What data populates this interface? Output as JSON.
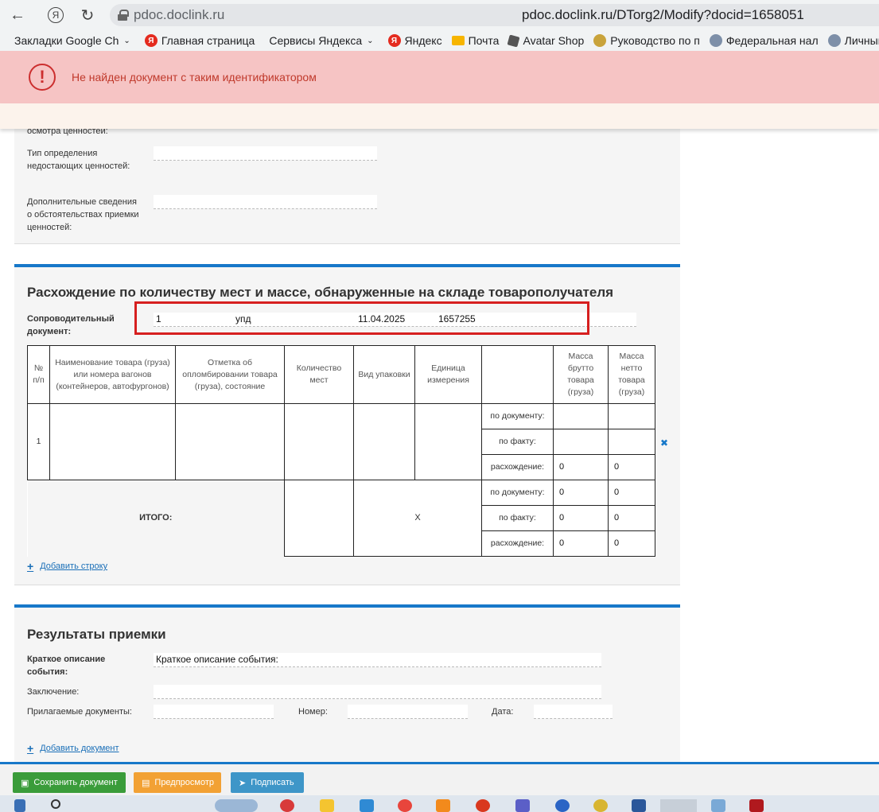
{
  "browser": {
    "host": "pdoc.doclink.ru",
    "url": "pdoc.doclink.ru/DTorg2/Modify?docid=1658051",
    "bookmarks": [
      {
        "label": "Закладки Google Ch",
        "icon": "none"
      },
      {
        "label": "Главная страница",
        "icon": "yandex-icon"
      },
      {
        "label": "Сервисы Яндекса",
        "icon": "none"
      },
      {
        "label": "Яндекс",
        "icon": "yandex-icon"
      },
      {
        "label": "Почта",
        "icon": "mail-icon"
      },
      {
        "label": "Avatar Shop",
        "icon": "shop-icon"
      },
      {
        "label": "Руководство по п",
        "icon": "gear-icon"
      },
      {
        "label": "Федеральная нал",
        "icon": "fns-icon"
      },
      {
        "label": "Личный кабине",
        "icon": "fns-icon"
      }
    ]
  },
  "error": {
    "message": "Не найден документ с таким идентификатором"
  },
  "section_top": {
    "label_cut": "осмотра ценностей:",
    "shortage_type_label": "Тип определения недостающих ценностей:",
    "additional_info_label": "Дополнительные сведения о обстоятельствах приемки ценностей:"
  },
  "discrepancy": {
    "title": "Расхождение по количеству мест и массе, обнаруженные на складе товарополучателя",
    "doc_label": "Сопроводительный документ:",
    "doc_fields": {
      "number": "1",
      "type": "упд",
      "date": "11.04.2025",
      "id": "1657255"
    },
    "headers": {
      "num": "№ п/п",
      "name": "Наименование товара (груза) или номера вагонов (контейнеров, автофургонов)",
      "seal": "Отметка об опломбировании товара (груза), состояние",
      "places": "Количество мест",
      "package": "Вид упаковки",
      "unit": "Единица измерения",
      "gross": "Масса брутто товара (груза)",
      "net": "Масса нетто товара (груза)"
    },
    "row": {
      "num": "1",
      "by_doc": "по документу:",
      "by_fact": "по факту:",
      "diff": "расхождение:",
      "diff_gross": "0",
      "diff_net": "0"
    },
    "total": {
      "label": "ИТОГО:",
      "x": "X",
      "by_doc": "по документу:",
      "by_fact": "по факту:",
      "diff": "расхождение:",
      "doc_gross": "0",
      "doc_net": "0",
      "fact_gross": "0",
      "fact_net": "0",
      "diff_gross": "0",
      "diff_net": "0"
    },
    "add_row": "Добавить строку"
  },
  "results": {
    "title": "Результаты приемки",
    "brief_label": "Краткое описание события:",
    "brief_value": "Краткое описание события:",
    "conclusion_label": "Заключение:",
    "attached_label": "Прилагаемые документы:",
    "number_label": "Номер:",
    "date_label": "Дата:",
    "add_document": "Добавить документ"
  },
  "actions": {
    "save": "Сохранить документ",
    "preview": "Предпросмотр",
    "sign": "Подписать"
  }
}
